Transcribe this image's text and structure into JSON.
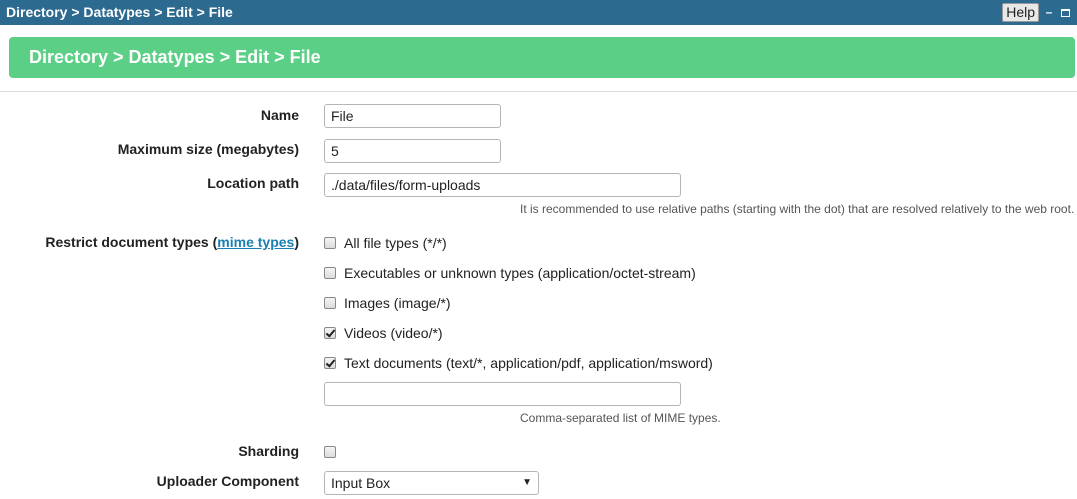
{
  "window": {
    "title": "Directory > Datatypes > Edit > File",
    "help_label": "Help",
    "minimize_glyph": "–"
  },
  "banner": {
    "title": "Directory > Datatypes > Edit > File"
  },
  "form": {
    "name": {
      "label": "Name",
      "value": "File"
    },
    "max_size": {
      "label": "Maximum size (megabytes)",
      "value": "5"
    },
    "location": {
      "label": "Location path",
      "value": "./data/files/form-uploads",
      "hint": "It is recommended to use relative paths (starting with the dot) that are resolved relatively to the web root."
    },
    "restrict": {
      "label_prefix": "Restrict document types (",
      "label_link": "mime types",
      "label_suffix": ")",
      "options": [
        {
          "label": "All file types (*/*)",
          "checked": false
        },
        {
          "label": "Executables or unknown types (application/octet-stream)",
          "checked": false
        },
        {
          "label": "Images (image/*)",
          "checked": false
        },
        {
          "label": "Videos (video/*)",
          "checked": true
        },
        {
          "label": "Text documents (text/*, application/pdf, application/msword)",
          "checked": true
        }
      ],
      "custom_value": "",
      "custom_hint": "Comma-separated list of MIME types."
    },
    "sharding": {
      "label": "Sharding",
      "checked": false
    },
    "uploader": {
      "label": "Uploader Component",
      "value": "Input Box",
      "arrow": "▼"
    }
  }
}
